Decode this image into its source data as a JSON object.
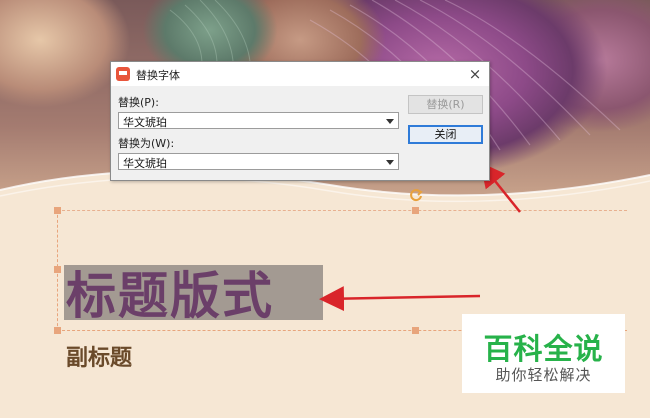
{
  "dialog": {
    "title": "替换字体",
    "replace_label": "替换(P):",
    "replace_value": "华文琥珀",
    "replace_with_label": "替换为(W):",
    "replace_with_value": "华文琥珀",
    "replace_button": "替换(R)",
    "close_button": "关闭",
    "close_icon": "×"
  },
  "slide": {
    "title": "标题版式",
    "subtitle": "副标题"
  },
  "watermark": {
    "main": "百科全说",
    "sub": "助你轻松解决"
  },
  "colors": {
    "accent_arrow": "#d9252a",
    "watermark_green": "#27b24a",
    "title_color": "#6b3f69",
    "focus_blue": "#2f7bd8"
  },
  "icons": {
    "app": "wps-presentation-icon",
    "rotate": "rotate-handle-icon",
    "dropdown": "chevron-down-icon"
  }
}
